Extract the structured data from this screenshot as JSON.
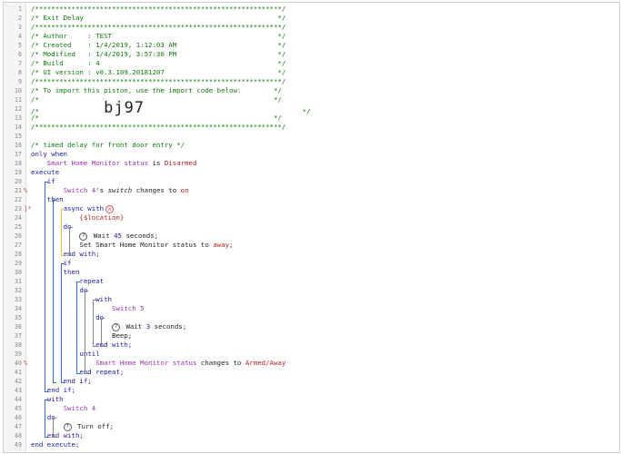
{
  "lines": [
    {
      "n": "1",
      "segs": [
        {
          "c": "c",
          "t": "/*************************************************************/"
        }
      ]
    },
    {
      "n": "2",
      "segs": [
        {
          "c": "c",
          "t": "/* Exit Delay                                                */"
        }
      ]
    },
    {
      "n": "3",
      "segs": [
        {
          "c": "c",
          "t": "/*************************************************************/"
        }
      ]
    },
    {
      "n": "4",
      "segs": [
        {
          "c": "c",
          "t": "/* Author     : TEST                                         */"
        }
      ]
    },
    {
      "n": "5",
      "segs": [
        {
          "c": "c",
          "t": "/* Created    : 1/4/2019, 1:12:03 AM                         */"
        }
      ]
    },
    {
      "n": "6",
      "segs": [
        {
          "c": "c",
          "t": "/* Modified   : 1/4/2019, 3:57:30 PM                         */"
        }
      ]
    },
    {
      "n": "7",
      "segs": [
        {
          "c": "c",
          "t": "/* Build      : 4                                            */"
        }
      ]
    },
    {
      "n": "8",
      "segs": [
        {
          "c": "c",
          "t": "/* UI version : v0.3.109.20181207                            */"
        }
      ]
    },
    {
      "n": "9",
      "segs": [
        {
          "c": "c",
          "t": "/*************************************************************/"
        }
      ]
    },
    {
      "n": "10",
      "segs": [
        {
          "c": "c",
          "t": "/* To import this piston, use the import code below:        */"
        }
      ]
    },
    {
      "n": "11",
      "segs": [
        {
          "c": "c",
          "t": "/*                                                          */"
        }
      ]
    },
    {
      "n": "12",
      "segs": [
        {
          "c": "c",
          "t": "/*                "
        },
        {
          "c": "big",
          "t": "bj97"
        },
        {
          "c": "c",
          "t": "                                       */"
        }
      ]
    },
    {
      "n": "13",
      "segs": [
        {
          "c": "c",
          "t": "/*                                                          */"
        }
      ]
    },
    {
      "n": "14",
      "segs": [
        {
          "c": "c",
          "t": "/*************************************************************/"
        }
      ]
    },
    {
      "n": "15",
      "segs": []
    },
    {
      "n": "16",
      "segs": [
        {
          "c": "c",
          "t": "/* timed delay for front door entry */"
        }
      ]
    },
    {
      "n": "17",
      "segs": [
        {
          "c": "k",
          "t": "only when"
        }
      ]
    },
    {
      "n": "18",
      "segs": [
        {
          "c": "p",
          "t": "    Smart Home Monitor status"
        },
        {
          "c": "t",
          "t": " is "
        },
        {
          "c": "s",
          "t": "Disarmed"
        }
      ]
    },
    {
      "n": "19",
      "segs": [
        {
          "c": "k",
          "t": "execute"
        }
      ]
    },
    {
      "n": "20",
      "segs": [
        {
          "c": "k",
          "t": "    if"
        }
      ]
    },
    {
      "n": "21",
      "mark": "%",
      "segs": [
        {
          "c": "p",
          "t": "        Switch 4"
        },
        {
          "c": "t",
          "t": "'s "
        },
        {
          "c": "em",
          "t": "switch"
        },
        {
          "c": "t",
          "t": " changes to "
        },
        {
          "c": "s",
          "t": "on"
        }
      ]
    },
    {
      "n": "22",
      "segs": [
        {
          "c": "k",
          "t": "    then"
        }
      ]
    },
    {
      "n": "23",
      "mark": "]*",
      "segs": [
        {
          "c": "k",
          "t": "        async with"
        },
        {
          "c": "cancel",
          "t": "x"
        }
      ]
    },
    {
      "n": "24",
      "segs": [
        {
          "c": "s",
          "t": "            {$location}"
        }
      ]
    },
    {
      "n": "25",
      "segs": [
        {
          "c": "k",
          "t": "        do"
        }
      ]
    },
    {
      "n": "26",
      "segs": [
        {
          "c": "t",
          "t": "            "
        },
        {
          "c": "help",
          "t": "?"
        },
        {
          "c": "t",
          "t": " Wait "
        },
        {
          "c": "n",
          "t": "45"
        },
        {
          "c": "t",
          "t": " seconds;"
        }
      ]
    },
    {
      "n": "27",
      "segs": [
        {
          "c": "t",
          "t": "            Set Smart Home Monitor status to "
        },
        {
          "c": "s",
          "t": "away"
        },
        {
          "c": "t",
          "t": ";"
        }
      ]
    },
    {
      "n": "28",
      "segs": [
        {
          "c": "k",
          "t": "        end with;"
        }
      ]
    },
    {
      "n": "29",
      "segs": [
        {
          "c": "k",
          "t": "        if"
        }
      ]
    },
    {
      "n": "30",
      "segs": [
        {
          "c": "k",
          "t": "        then"
        }
      ]
    },
    {
      "n": "31",
      "segs": [
        {
          "c": "k",
          "t": "            repeat"
        }
      ]
    },
    {
      "n": "32",
      "segs": [
        {
          "c": "k",
          "t": "            do"
        }
      ]
    },
    {
      "n": "33",
      "segs": [
        {
          "c": "k",
          "t": "                with"
        }
      ]
    },
    {
      "n": "34",
      "segs": [
        {
          "c": "p",
          "t": "                    Switch 5"
        }
      ]
    },
    {
      "n": "35",
      "segs": [
        {
          "c": "k",
          "t": "                do"
        }
      ]
    },
    {
      "n": "36",
      "segs": [
        {
          "c": "t",
          "t": "                    "
        },
        {
          "c": "help",
          "t": "?"
        },
        {
          "c": "t",
          "t": " Wait "
        },
        {
          "c": "n",
          "t": "3"
        },
        {
          "c": "t",
          "t": " seconds;"
        }
      ]
    },
    {
      "n": "37",
      "segs": [
        {
          "c": "t",
          "t": "                    Beep;"
        }
      ]
    },
    {
      "n": "38",
      "segs": [
        {
          "c": "k",
          "t": "                end with;"
        }
      ]
    },
    {
      "n": "39",
      "segs": [
        {
          "c": "k",
          "t": "            until"
        }
      ]
    },
    {
      "n": "40",
      "mark": "%",
      "segs": [
        {
          "c": "p",
          "t": "                Smart Home Monitor status"
        },
        {
          "c": "t",
          "t": " changes to "
        },
        {
          "c": "s",
          "t": "Armed/Away"
        }
      ]
    },
    {
      "n": "41",
      "segs": [
        {
          "c": "k",
          "t": "            end repeat;"
        }
      ]
    },
    {
      "n": "42",
      "segs": [
        {
          "c": "k",
          "t": "        end if;"
        }
      ]
    },
    {
      "n": "43",
      "segs": [
        {
          "c": "k",
          "t": "    end if;"
        }
      ]
    },
    {
      "n": "44",
      "segs": [
        {
          "c": "k",
          "t": "    with"
        }
      ]
    },
    {
      "n": "45",
      "segs": [
        {
          "c": "p",
          "t": "        Switch 4"
        }
      ]
    },
    {
      "n": "46",
      "segs": [
        {
          "c": "k",
          "t": "    do"
        }
      ]
    },
    {
      "n": "47",
      "segs": [
        {
          "c": "t",
          "t": "        "
        },
        {
          "c": "help",
          "t": "?"
        },
        {
          "c": "t",
          "t": " Turn off;"
        }
      ]
    },
    {
      "n": "48",
      "segs": [
        {
          "c": "k",
          "t": "    end with;"
        }
      ]
    },
    {
      "n": "49",
      "segs": [
        {
          "c": "k",
          "t": "end execute;"
        }
      ]
    }
  ],
  "brackets": [
    {
      "from": 20,
      "to": 43,
      "indent": 4,
      "color": "blue"
    },
    {
      "from": 22,
      "to": 42,
      "indent": 6,
      "color": "blue"
    },
    {
      "from": 23,
      "to": 28,
      "indent": 8,
      "color": "yellow"
    },
    {
      "from": 25,
      "to": 28,
      "indent": 10,
      "color": "gray"
    },
    {
      "from": 29,
      "to": 42,
      "indent": 8,
      "color": "blue"
    },
    {
      "from": 31,
      "to": 41,
      "indent": 12,
      "color": "blue"
    },
    {
      "from": 32,
      "to": 41,
      "indent": 14,
      "color": "gray"
    },
    {
      "from": 33,
      "to": 38,
      "indent": 16,
      "color": "gray"
    },
    {
      "from": 35,
      "to": 38,
      "indent": 18,
      "color": "gray"
    },
    {
      "from": 44,
      "to": 48,
      "indent": 4,
      "color": "blue"
    },
    {
      "from": 46,
      "to": 48,
      "indent": 6,
      "color": "gray"
    }
  ]
}
